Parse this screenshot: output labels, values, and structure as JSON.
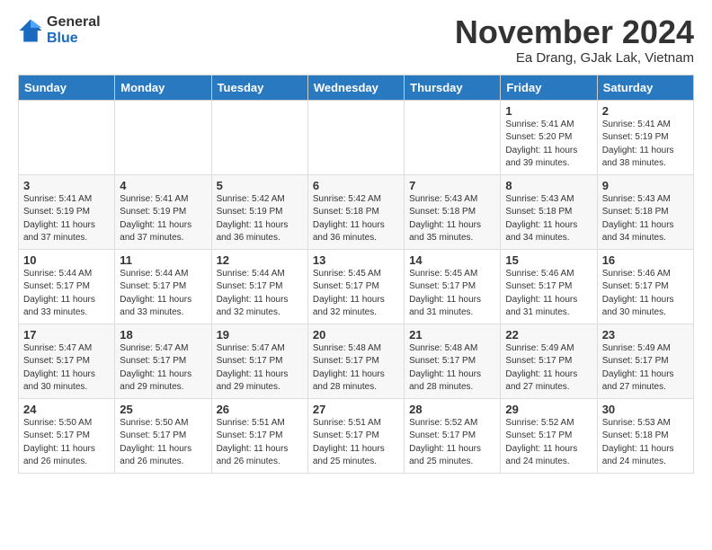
{
  "logo": {
    "general": "General",
    "blue": "Blue"
  },
  "title": "November 2024",
  "location": "Ea Drang, GJak Lak, Vietnam",
  "weekdays": [
    "Sunday",
    "Monday",
    "Tuesday",
    "Wednesday",
    "Thursday",
    "Friday",
    "Saturday"
  ],
  "weeks": [
    [
      {
        "day": "",
        "info": ""
      },
      {
        "day": "",
        "info": ""
      },
      {
        "day": "",
        "info": ""
      },
      {
        "day": "",
        "info": ""
      },
      {
        "day": "",
        "info": ""
      },
      {
        "day": "1",
        "info": "Sunrise: 5:41 AM\nSunset: 5:20 PM\nDaylight: 11 hours\nand 39 minutes."
      },
      {
        "day": "2",
        "info": "Sunrise: 5:41 AM\nSunset: 5:19 PM\nDaylight: 11 hours\nand 38 minutes."
      }
    ],
    [
      {
        "day": "3",
        "info": "Sunrise: 5:41 AM\nSunset: 5:19 PM\nDaylight: 11 hours\nand 37 minutes."
      },
      {
        "day": "4",
        "info": "Sunrise: 5:41 AM\nSunset: 5:19 PM\nDaylight: 11 hours\nand 37 minutes."
      },
      {
        "day": "5",
        "info": "Sunrise: 5:42 AM\nSunset: 5:19 PM\nDaylight: 11 hours\nand 36 minutes."
      },
      {
        "day": "6",
        "info": "Sunrise: 5:42 AM\nSunset: 5:18 PM\nDaylight: 11 hours\nand 36 minutes."
      },
      {
        "day": "7",
        "info": "Sunrise: 5:43 AM\nSunset: 5:18 PM\nDaylight: 11 hours\nand 35 minutes."
      },
      {
        "day": "8",
        "info": "Sunrise: 5:43 AM\nSunset: 5:18 PM\nDaylight: 11 hours\nand 34 minutes."
      },
      {
        "day": "9",
        "info": "Sunrise: 5:43 AM\nSunset: 5:18 PM\nDaylight: 11 hours\nand 34 minutes."
      }
    ],
    [
      {
        "day": "10",
        "info": "Sunrise: 5:44 AM\nSunset: 5:17 PM\nDaylight: 11 hours\nand 33 minutes."
      },
      {
        "day": "11",
        "info": "Sunrise: 5:44 AM\nSunset: 5:17 PM\nDaylight: 11 hours\nand 33 minutes."
      },
      {
        "day": "12",
        "info": "Sunrise: 5:44 AM\nSunset: 5:17 PM\nDaylight: 11 hours\nand 32 minutes."
      },
      {
        "day": "13",
        "info": "Sunrise: 5:45 AM\nSunset: 5:17 PM\nDaylight: 11 hours\nand 32 minutes."
      },
      {
        "day": "14",
        "info": "Sunrise: 5:45 AM\nSunset: 5:17 PM\nDaylight: 11 hours\nand 31 minutes."
      },
      {
        "day": "15",
        "info": "Sunrise: 5:46 AM\nSunset: 5:17 PM\nDaylight: 11 hours\nand 31 minutes."
      },
      {
        "day": "16",
        "info": "Sunrise: 5:46 AM\nSunset: 5:17 PM\nDaylight: 11 hours\nand 30 minutes."
      }
    ],
    [
      {
        "day": "17",
        "info": "Sunrise: 5:47 AM\nSunset: 5:17 PM\nDaylight: 11 hours\nand 30 minutes."
      },
      {
        "day": "18",
        "info": "Sunrise: 5:47 AM\nSunset: 5:17 PM\nDaylight: 11 hours\nand 29 minutes."
      },
      {
        "day": "19",
        "info": "Sunrise: 5:47 AM\nSunset: 5:17 PM\nDaylight: 11 hours\nand 29 minutes."
      },
      {
        "day": "20",
        "info": "Sunrise: 5:48 AM\nSunset: 5:17 PM\nDaylight: 11 hours\nand 28 minutes."
      },
      {
        "day": "21",
        "info": "Sunrise: 5:48 AM\nSunset: 5:17 PM\nDaylight: 11 hours\nand 28 minutes."
      },
      {
        "day": "22",
        "info": "Sunrise: 5:49 AM\nSunset: 5:17 PM\nDaylight: 11 hours\nand 27 minutes."
      },
      {
        "day": "23",
        "info": "Sunrise: 5:49 AM\nSunset: 5:17 PM\nDaylight: 11 hours\nand 27 minutes."
      }
    ],
    [
      {
        "day": "24",
        "info": "Sunrise: 5:50 AM\nSunset: 5:17 PM\nDaylight: 11 hours\nand 26 minutes."
      },
      {
        "day": "25",
        "info": "Sunrise: 5:50 AM\nSunset: 5:17 PM\nDaylight: 11 hours\nand 26 minutes."
      },
      {
        "day": "26",
        "info": "Sunrise: 5:51 AM\nSunset: 5:17 PM\nDaylight: 11 hours\nand 26 minutes."
      },
      {
        "day": "27",
        "info": "Sunrise: 5:51 AM\nSunset: 5:17 PM\nDaylight: 11 hours\nand 25 minutes."
      },
      {
        "day": "28",
        "info": "Sunrise: 5:52 AM\nSunset: 5:17 PM\nDaylight: 11 hours\nand 25 minutes."
      },
      {
        "day": "29",
        "info": "Sunrise: 5:52 AM\nSunset: 5:17 PM\nDaylight: 11 hours\nand 24 minutes."
      },
      {
        "day": "30",
        "info": "Sunrise: 5:53 AM\nSunset: 5:18 PM\nDaylight: 11 hours\nand 24 minutes."
      }
    ]
  ]
}
